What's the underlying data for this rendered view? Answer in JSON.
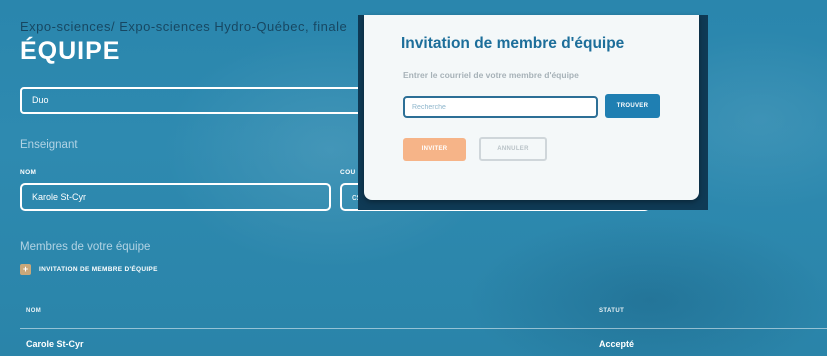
{
  "breadcrumb": {
    "text": "Expo-sciences/ Expo-sciences Hydro-Québec, finale"
  },
  "page": {
    "title": "ÉQUIPE",
    "team_name_value": "Duo"
  },
  "teacher": {
    "section_label": "Enseignant",
    "name_label": "NOM",
    "email_label": "COU",
    "name_value": "Karole St-Cyr",
    "email_value": "cs"
  },
  "members": {
    "section_label": "Membres de votre équipe",
    "invite_icon": "plus-icon",
    "invite_link_label": "INVITATION DE MEMBRE D'ÉQUIPE",
    "columns": [
      "NOM",
      "STATUT"
    ],
    "rows": [
      {
        "name": "Carole St-Cyr",
        "status": "Accepté"
      }
    ]
  },
  "modal": {
    "title": "Invitation de membre d'équipe",
    "prompt": "Entrer le courriel de votre membre d'équipe",
    "search_placeholder": "Recherche",
    "find_label": "TROUVER",
    "invite_label": "INVITER",
    "cancel_label": "ANNULER"
  },
  "colors": {
    "background": "#2d88ae",
    "modal_title": "#1c6e9a",
    "primary_button": "#1f7fb2",
    "invite_button": "#f6b488"
  }
}
